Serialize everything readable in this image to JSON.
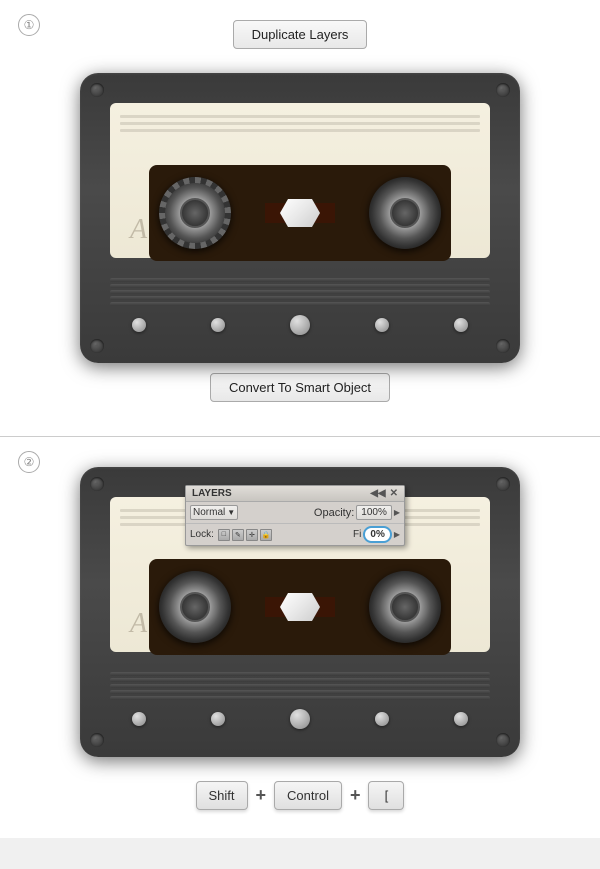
{
  "section1": {
    "step_number": "①",
    "button_label": "Duplicate Layers",
    "cassette": {
      "label_letter": "A",
      "reel_left": "left-reel",
      "reel_right": "right-reel"
    },
    "convert_button_label": "Convert To Smart Object"
  },
  "section2": {
    "step_number": "②",
    "layers_panel": {
      "title": "LAYERS",
      "collapse_icon": "◀◀",
      "close_icon": "✕",
      "menu_icon": "≡",
      "blend_mode": "Normal",
      "opacity_label": "Opacity:",
      "opacity_value": "100%",
      "lock_label": "Lock:",
      "lock_icons": [
        "□",
        "✎",
        "✛",
        "🔒"
      ],
      "fill_label": "Fi",
      "fill_value": "0%"
    },
    "cassette": {
      "label_letter": "A"
    },
    "shortcut": {
      "key1": "Shift",
      "plus1": "+",
      "key2": "Control",
      "plus2": "+",
      "key3": "["
    }
  }
}
